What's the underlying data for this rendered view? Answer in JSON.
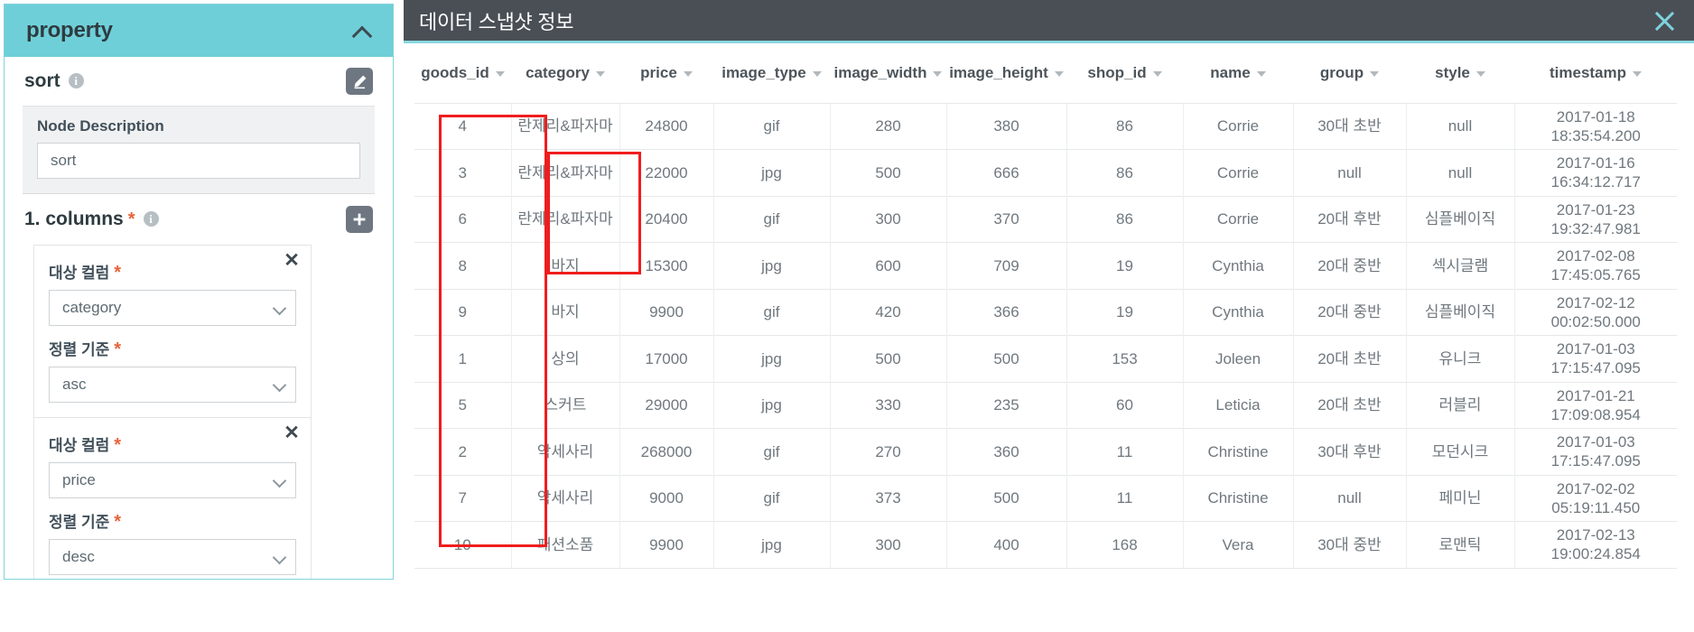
{
  "property_panel": {
    "header": {
      "title": "property",
      "collapse_icon": "chevron-up-icon"
    },
    "node": {
      "name": "sort",
      "info_icon": "info-icon",
      "edit_icon": "edit-pencil-icon",
      "description_label": "Node Description",
      "description_value": "sort",
      "description_placeholder": "sort"
    },
    "columns_section": {
      "title": "1. columns",
      "required_marker": "*",
      "info_icon": "info-icon",
      "add_icon": "plus-icon",
      "items": [
        {
          "close_icon": "close-icon",
          "target_column_label": "대상 컬럼",
          "target_column_required": "*",
          "target_column_value": "category",
          "sort_order_label": "정렬 기준",
          "sort_order_required": "*",
          "sort_order_value": "asc"
        },
        {
          "close_icon": "close-icon",
          "target_column_label": "대상 컬럼",
          "target_column_required": "*",
          "target_column_value": "price",
          "sort_order_label": "정렬 기준",
          "sort_order_required": "*",
          "sort_order_value": "desc"
        }
      ]
    }
  },
  "snapshot_dialog": {
    "title": "데이터 스냅샷 정보",
    "close_icon": "close-icon",
    "columns": [
      {
        "key": "goods_id",
        "label": "goods_id"
      },
      {
        "key": "category",
        "label": "category"
      },
      {
        "key": "price",
        "label": "price"
      },
      {
        "key": "image_type",
        "label": "image_type"
      },
      {
        "key": "image_width",
        "label": "image_width"
      },
      {
        "key": "image_height",
        "label": "image_height"
      },
      {
        "key": "shop_id",
        "label": "shop_id"
      },
      {
        "key": "name",
        "label": "name"
      },
      {
        "key": "group",
        "label": "group"
      },
      {
        "key": "style",
        "label": "style"
      },
      {
        "key": "timestamp",
        "label": "timestamp"
      }
    ],
    "rows": [
      {
        "goods_id": "4",
        "category": "란제리&파자마",
        "price": "24800",
        "image_type": "gif",
        "image_width": "280",
        "image_height": "380",
        "shop_id": "86",
        "name": "Corrie",
        "group": "30대 초반",
        "style": "null",
        "ts_date": "2017-01-18",
        "ts_time": "18:35:54.200"
      },
      {
        "goods_id": "3",
        "category": "란제리&파자마",
        "price": "22000",
        "image_type": "jpg",
        "image_width": "500",
        "image_height": "666",
        "shop_id": "86",
        "name": "Corrie",
        "group": "null",
        "style": "null",
        "ts_date": "2017-01-16",
        "ts_time": "16:34:12.717"
      },
      {
        "goods_id": "6",
        "category": "란제리&파자마",
        "price": "20400",
        "image_type": "gif",
        "image_width": "300",
        "image_height": "370",
        "shop_id": "86",
        "name": "Corrie",
        "group": "20대 후반",
        "style": "심플베이직",
        "ts_date": "2017-01-23",
        "ts_time": "19:32:47.981"
      },
      {
        "goods_id": "8",
        "category": "바지",
        "price": "15300",
        "image_type": "jpg",
        "image_width": "600",
        "image_height": "709",
        "shop_id": "19",
        "name": "Cynthia",
        "group": "20대 중반",
        "style": "섹시글램",
        "ts_date": "2017-02-08",
        "ts_time": "17:45:05.765"
      },
      {
        "goods_id": "9",
        "category": "바지",
        "price": "9900",
        "image_type": "gif",
        "image_width": "420",
        "image_height": "366",
        "shop_id": "19",
        "name": "Cynthia",
        "group": "20대 중반",
        "style": "심플베이직",
        "ts_date": "2017-02-12",
        "ts_time": "00:02:50.000"
      },
      {
        "goods_id": "1",
        "category": "상의",
        "price": "17000",
        "image_type": "jpg",
        "image_width": "500",
        "image_height": "500",
        "shop_id": "153",
        "name": "Joleen",
        "group": "20대 초반",
        "style": "유니크",
        "ts_date": "2017-01-03",
        "ts_time": "17:15:47.095"
      },
      {
        "goods_id": "5",
        "category": "스커트",
        "price": "29000",
        "image_type": "jpg",
        "image_width": "330",
        "image_height": "235",
        "shop_id": "60",
        "name": "Leticia",
        "group": "20대 초반",
        "style": "러블리",
        "ts_date": "2017-01-21",
        "ts_time": "17:09:08.954"
      },
      {
        "goods_id": "2",
        "category": "악세사리",
        "price": "268000",
        "image_type": "gif",
        "image_width": "270",
        "image_height": "360",
        "shop_id": "11",
        "name": "Christine",
        "group": "30대 후반",
        "style": "모던시크",
        "ts_date": "2017-01-03",
        "ts_time": "17:15:47.095"
      },
      {
        "goods_id": "7",
        "category": "악세사리",
        "price": "9000",
        "image_type": "gif",
        "image_width": "373",
        "image_height": "500",
        "shop_id": "11",
        "name": "Christine",
        "group": "null",
        "style": "페미닌",
        "ts_date": "2017-02-02",
        "ts_time": "05:19:11.450"
      },
      {
        "goods_id": "10",
        "category": "패션소품",
        "price": "9900",
        "image_type": "jpg",
        "image_width": "300",
        "image_height": "400",
        "shop_id": "168",
        "name": "Vera",
        "group": "30대 중반",
        "style": "로맨틱",
        "ts_date": "2017-02-13",
        "ts_time": "19:00:24.854"
      }
    ],
    "annotations": [
      {
        "name": "category-column-highlight",
        "color": "#ef1d1d"
      },
      {
        "name": "price-cells-highlight",
        "color": "#ef1d1d"
      }
    ]
  },
  "colors": {
    "panel_header_bg": "#6fcfd8",
    "dialog_header_bg": "#4a4f56",
    "dialog_accent": "#8ad7e0",
    "required_star": "#e8623b",
    "annotation_red": "#ef1d1d"
  }
}
